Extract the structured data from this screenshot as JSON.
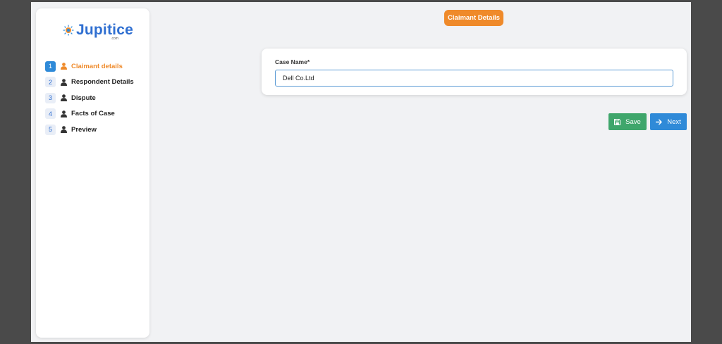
{
  "brand": {
    "name": "Jupitice",
    "domain": ".com"
  },
  "sidebar": {
    "steps": [
      {
        "number": "1",
        "label": "Claimant details",
        "active": true
      },
      {
        "number": "2",
        "label": "Respondent Details"
      },
      {
        "number": "3",
        "label": "Dispute"
      },
      {
        "number": "4",
        "label": "Facts of Case"
      },
      {
        "number": "5",
        "label": "Preview"
      }
    ],
    "step_icon": "user-icon"
  },
  "header": {
    "title": "Claimant Details"
  },
  "form": {
    "case_name_label": "Case Name*",
    "case_name_value": "Dell Co.Ltd"
  },
  "actions": {
    "save_label": "Save",
    "save_icon": "floppy-disk-icon",
    "next_label": "Next",
    "next_icon": "arrow-right-icon"
  },
  "colors": {
    "accent_orange": "#ef8a2a",
    "primary_blue": "#2f8ad8",
    "save_green": "#3fa66b"
  }
}
